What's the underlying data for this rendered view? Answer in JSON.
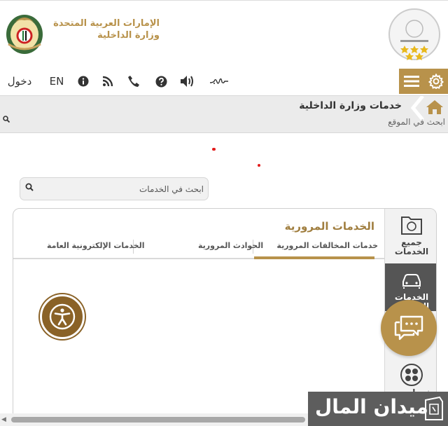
{
  "header": {
    "ministry_line1": "الإمارات العربية المتحدة",
    "ministry_line2": "وزارة الداخلية"
  },
  "toolbar": {
    "login": "دخول",
    "language": "EN",
    "icons": [
      "info-icon",
      "rss-icon",
      "phone-icon",
      "help-icon",
      "sound-icon",
      "sign-language-icon"
    ]
  },
  "breadcrumb": {
    "current": "خدمات وزارة الداخلية"
  },
  "site_search": {
    "placeholder": "ابحث في الموقع"
  },
  "services_search": {
    "placeholder": "ابحث في الخدمات"
  },
  "panel": {
    "title": "الخدمات المرورية",
    "tabs": [
      {
        "label": "خدمات المخالفات المرورية",
        "active": true
      },
      {
        "label": "الحوادث المرورية",
        "active": false
      },
      {
        "label": "الخدمات الإلكترونية العامة",
        "active": false
      }
    ],
    "side_nav": [
      {
        "label": "جميع الخدمات"
      },
      {
        "label": "الخدمات المرورية"
      },
      {
        "label": "خدمات ..."
      }
    ]
  },
  "watermark": {
    "text": "ميدان المال"
  },
  "colors": {
    "gold": "#b8924b",
    "dark_gold": "#8a6227",
    "active_side": "#555555"
  }
}
